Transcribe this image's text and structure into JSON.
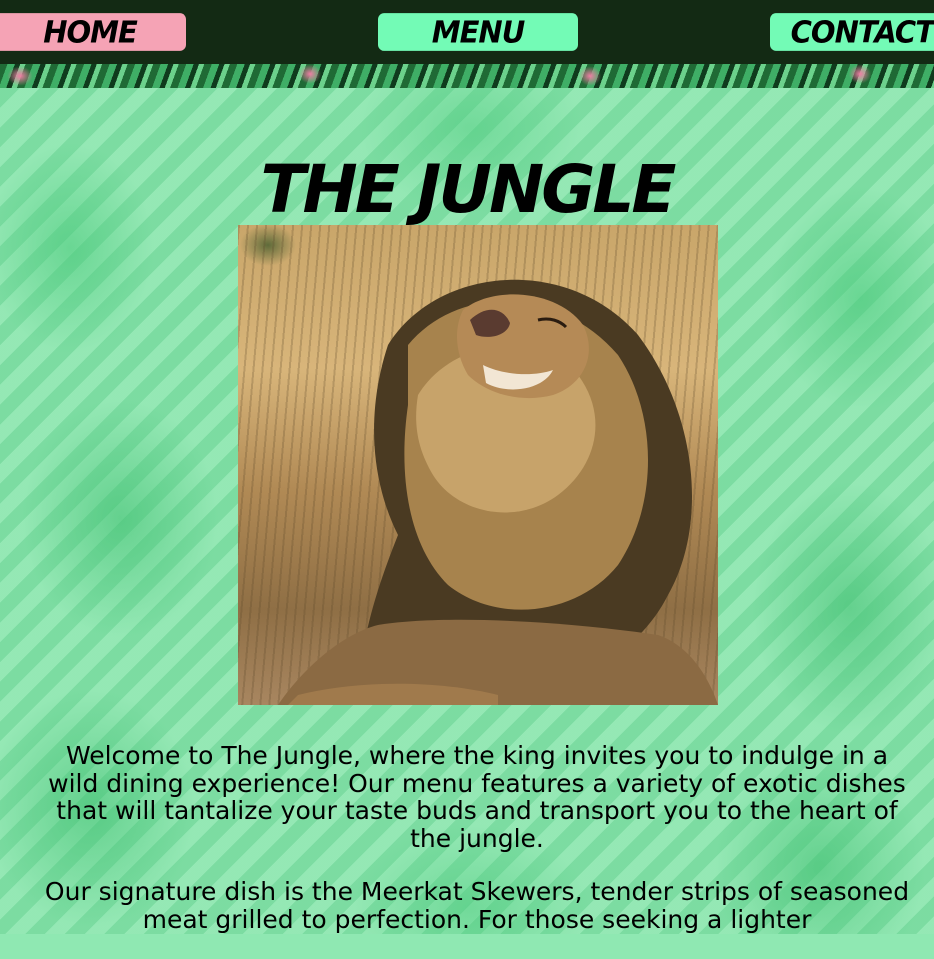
{
  "nav": {
    "home_label": "Home",
    "menu_label": "Menu",
    "contact_label": "Contact"
  },
  "page": {
    "title": "The Jungle"
  },
  "content": {
    "paragraph_1": "Welcome to The Jungle, where the king invites you to indulge in a wild dining experience! Our menu features a variety of exotic dishes that will tantalize your taste buds and transport you to the heart of the jungle.",
    "paragraph_2": "Our signature dish is the Meerkat Skewers, tender strips of seasoned meat grilled to perfection. For those seeking a lighter"
  },
  "colors": {
    "nav_background": "#132a14",
    "home_button": "#f5a3b5",
    "nav_button": "#73fbb6",
    "page_background": "#8ee7b0"
  },
  "images": {
    "hero": "lion-photo"
  }
}
